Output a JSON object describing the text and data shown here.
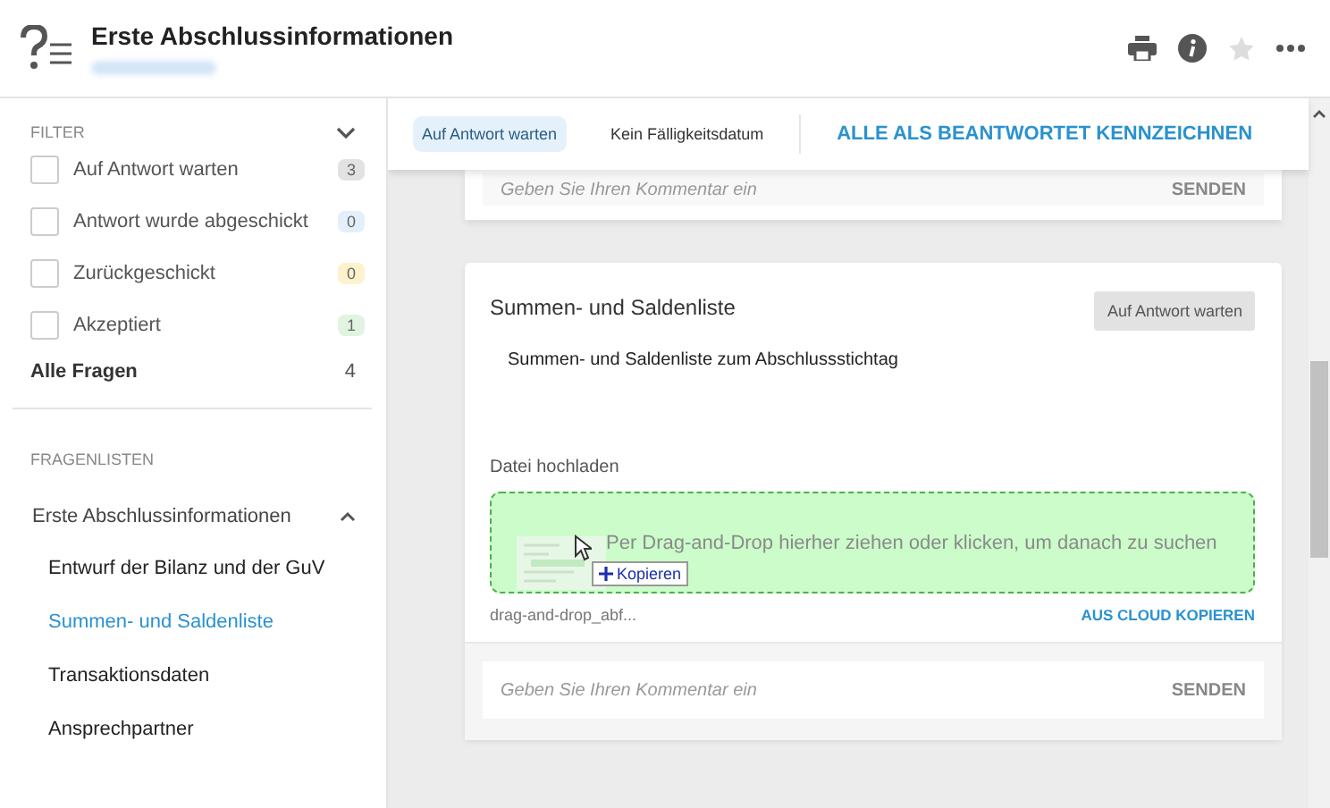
{
  "header": {
    "title": "Erste Abschlussinformationen"
  },
  "filter": {
    "heading": "FILTER",
    "items": [
      {
        "label": "Auf Antwort warten",
        "count": "3",
        "color": "#e2e2e2",
        "checked": false
      },
      {
        "label": "Antwort wurde abgeschickt",
        "count": "0",
        "color": "#e3effa",
        "checked": false
      },
      {
        "label": "Zurückgeschickt",
        "count": "0",
        "color": "#fcf2cc",
        "checked": false
      },
      {
        "label": "Akzeptiert",
        "count": "1",
        "color": "#e1f4e1",
        "checked": false
      }
    ],
    "total": {
      "label": "Alle Fragen",
      "count": "4"
    }
  },
  "lists": {
    "heading": "FRAGENLISTEN",
    "group": {
      "label": "Erste Abschlussinformationen",
      "expanded": true,
      "children": [
        {
          "label": "Entwurf der Bilanz und der GuV",
          "selected": false
        },
        {
          "label": "Summen- und Saldenliste",
          "selected": true
        },
        {
          "label": "Transaktionsdaten",
          "selected": false
        },
        {
          "label": "Ansprechpartner",
          "selected": false
        }
      ]
    }
  },
  "toolbar": {
    "status": "Auf Antwort warten",
    "due": "Kein Fälligkeitsdatum",
    "action": "ALLE ALS BEANTWORTET KENNZEICHNEN"
  },
  "previous_card": {
    "comment": {
      "placeholder": "Geben Sie Ihren Kommentar ein"
    },
    "send": "SENDEN"
  },
  "card": {
    "title": "Summen- und Saldenliste",
    "status": "Auf Antwort warten",
    "description": "Summen- und Saldenliste zum Abschlussstichtag",
    "upload": {
      "label": "Datei hochladen",
      "dropzone": "Per Drag-and-Drop hierher ziehen oder klicken, um danach zu suchen",
      "drag_badge": "Kopieren",
      "file": "drag-and-drop_abf...",
      "cloud": "AUS CLOUD KOPIEREN"
    },
    "comment": {
      "placeholder": "Geben Sie Ihren Kommentar ein"
    },
    "send": "SENDEN"
  }
}
